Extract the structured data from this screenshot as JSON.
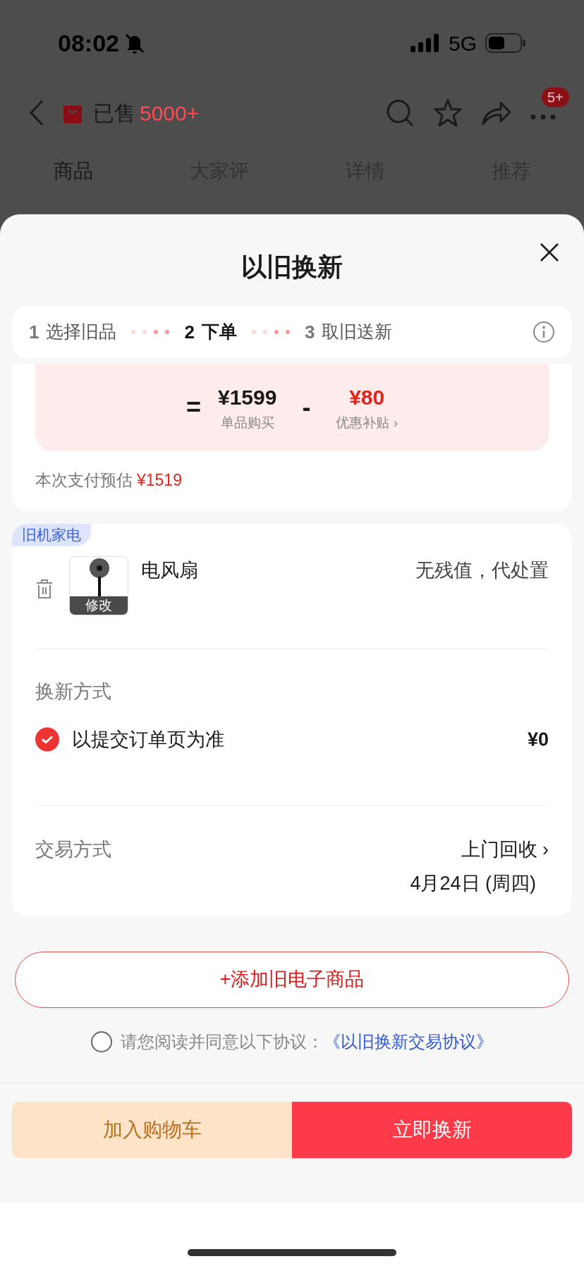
{
  "status_bar": {
    "time": "08:02",
    "network": "5G"
  },
  "nav": {
    "sold_label": "已售",
    "sold_count": "5000+",
    "more_badge": "5+"
  },
  "tabs": [
    {
      "label": "商品",
      "selected": true
    },
    {
      "label": "大家评",
      "selected": false
    },
    {
      "label": "详情",
      "selected": false
    },
    {
      "label": "推荐",
      "selected": false
    }
  ],
  "sheet": {
    "title": "以旧换新",
    "steps": [
      {
        "number": "1",
        "label": "选择旧品",
        "selected": false
      },
      {
        "number": "2",
        "label": "下单",
        "selected": true
      },
      {
        "number": "3",
        "label": "取旧送新",
        "selected": false
      }
    ],
    "price": {
      "equals": "=",
      "base_price": "¥1599",
      "base_label": "单品购买",
      "minus": "-",
      "subsidy": "¥80",
      "subsidy_label": "优惠补贴 ›",
      "estimate_label": "本次支付预估",
      "estimate_value": "¥1519"
    },
    "old_item": {
      "tag": "旧机家电",
      "thumb_label": "修改",
      "name": "电风扇",
      "value": "无残值，代处置"
    },
    "renew": {
      "heading": "换新方式",
      "option": "以提交订单页为准",
      "checked": true,
      "price": "¥0"
    },
    "trade": {
      "heading": "交易方式",
      "method": "上门回收 ›",
      "date": "4月24日 (周四)"
    },
    "add_button": "+添加旧电子商品",
    "agreement": {
      "checked": false,
      "text": "请您阅读并同意以下协议：",
      "link": "《以旧换新交易协议》"
    },
    "buttons": {
      "cart": "加入购物车",
      "exchange": "立即换新"
    }
  }
}
